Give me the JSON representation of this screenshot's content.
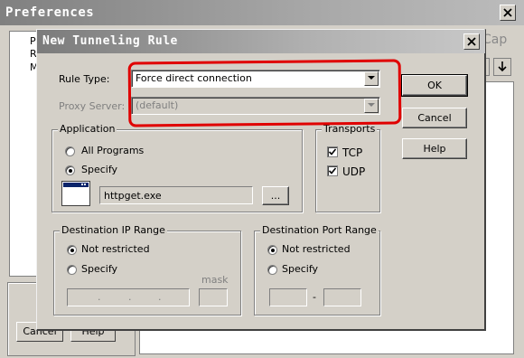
{
  "background_window": {
    "title": "Preferences",
    "tree_items": [
      "P",
      "R",
      "M"
    ],
    "cap_label": "Cap",
    "cancel_label": "Cancel",
    "help_label": "Help"
  },
  "dialog": {
    "title": "New Tunneling Rule",
    "rule_type": {
      "label": "Rule Type:",
      "value": "Force direct connection"
    },
    "proxy_server": {
      "label": "Proxy Server:",
      "value": "(default)"
    },
    "buttons": {
      "ok": "OK",
      "cancel": "Cancel",
      "help": "Help"
    },
    "application": {
      "caption": "Application",
      "all_programs": "All Programs",
      "specify": "Specify",
      "selected": "Specify",
      "program": "httpget.exe",
      "browse": "..."
    },
    "transports": {
      "caption": "Transports",
      "tcp": {
        "label": "TCP",
        "checked": true
      },
      "udp": {
        "label": "UDP",
        "checked": true
      }
    },
    "destination_ip": {
      "caption": "Destination IP Range",
      "not_restricted": "Not restricted",
      "specify": "Specify",
      "selected": "Not restricted",
      "mask_label": "mask"
    },
    "destination_port": {
      "caption": "Destination Port Range",
      "not_restricted": "Not restricted",
      "specify": "Specify",
      "selected": "Not restricted",
      "separator": "-"
    }
  },
  "colors": {
    "highlight": "#e00000",
    "face": "#d4d0c8"
  }
}
